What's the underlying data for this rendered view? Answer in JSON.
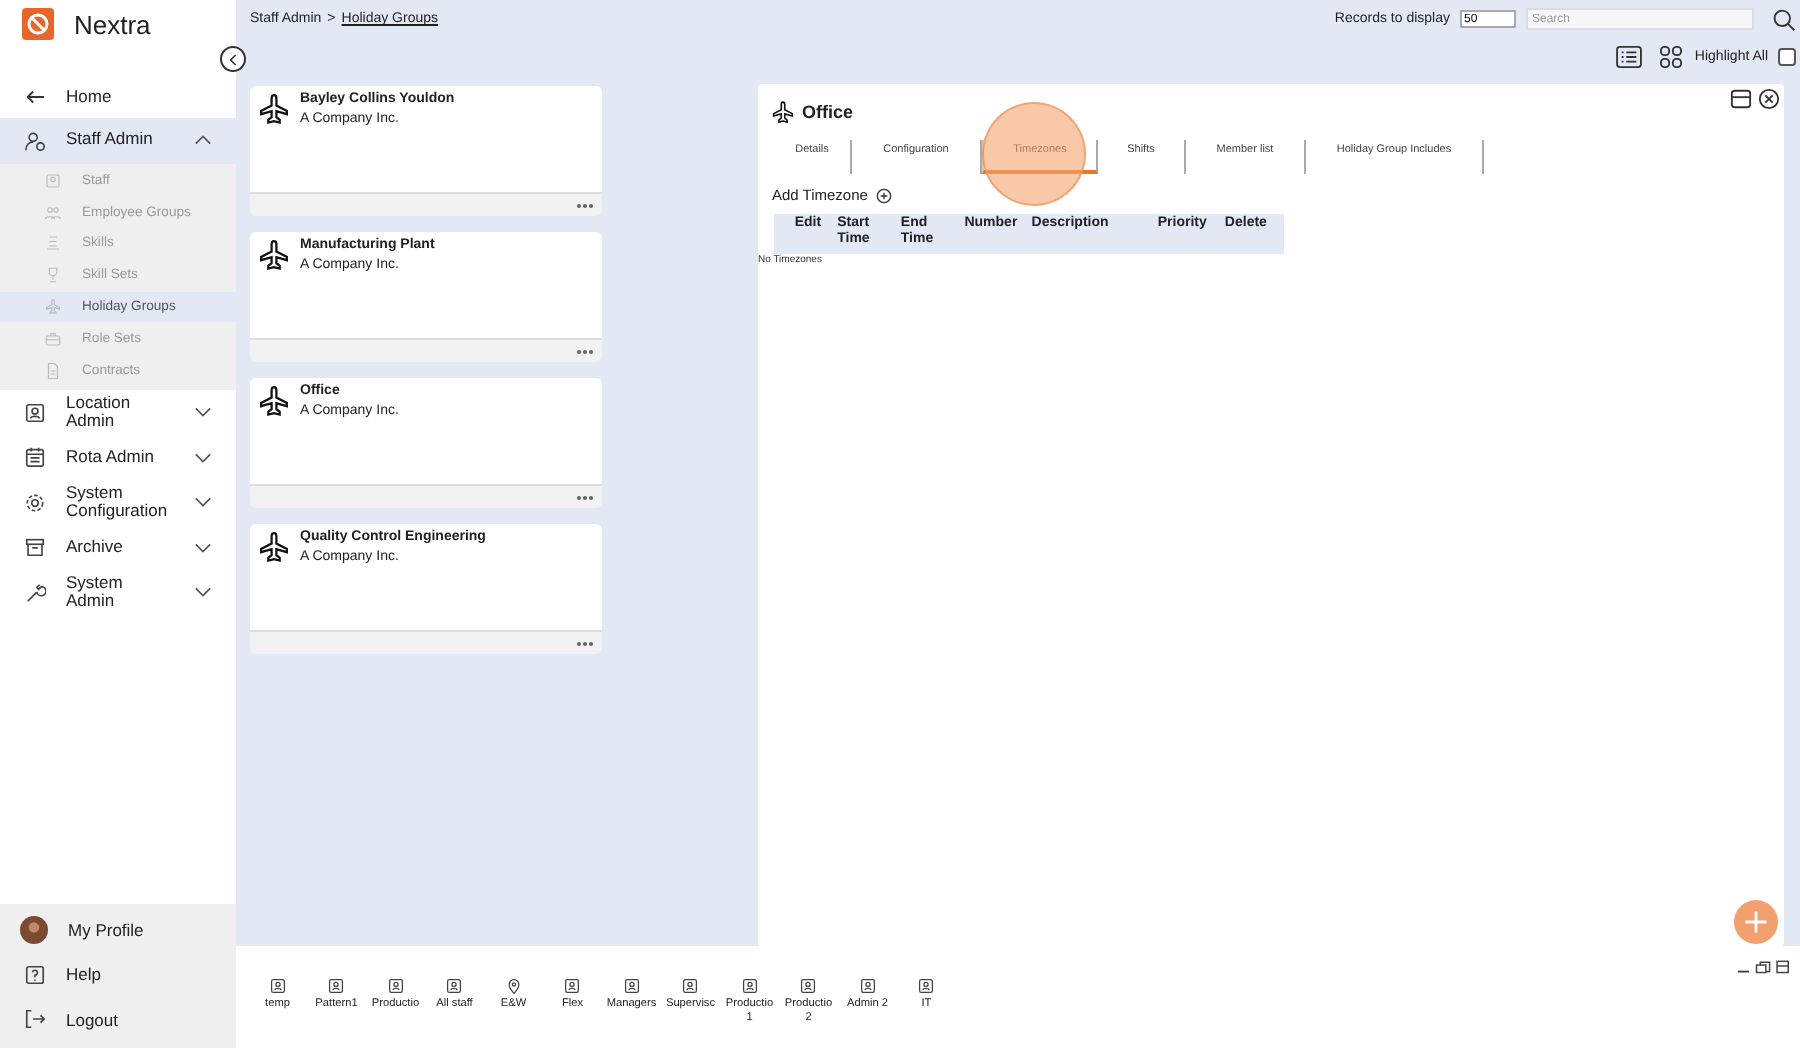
{
  "app": {
    "name": "Nextra"
  },
  "nav": {
    "home": "Home",
    "sections": [
      {
        "label": "Staff Admin",
        "expanded": true,
        "items": [
          {
            "label": "Staff",
            "selected": false
          },
          {
            "label": "Employee Groups",
            "selected": false
          },
          {
            "label": "Skills",
            "selected": false
          },
          {
            "label": "Skill Sets",
            "selected": false
          },
          {
            "label": "Holiday Groups",
            "selected": true
          },
          {
            "label": "Role Sets",
            "selected": false
          },
          {
            "label": "Contracts",
            "selected": false
          }
        ]
      },
      {
        "label": "Location Admin",
        "expanded": false
      },
      {
        "label": "Rota Admin",
        "expanded": false
      },
      {
        "label": "System Configuration",
        "expanded": false
      },
      {
        "label": "Archive",
        "expanded": false
      },
      {
        "label": "System Admin",
        "expanded": false
      }
    ]
  },
  "footer_nav": [
    {
      "label": "My Profile",
      "kind": "avatar"
    },
    {
      "label": "Help",
      "kind": "help"
    },
    {
      "label": "Logout",
      "kind": "logout"
    }
  ],
  "breadcrumb": {
    "parent": "Staff Admin",
    "separator": ">",
    "current": "Holiday Groups"
  },
  "toolbar": {
    "records_label": "Records to display",
    "records_value": "50",
    "search_placeholder": "Search",
    "highlight_label": "Highlight All",
    "highlight_checked": false
  },
  "cards": [
    {
      "title": "Bayley Collins Youldon",
      "subtitle": "A Company Inc."
    },
    {
      "title": "Manufacturing Plant",
      "subtitle": "A Company Inc."
    },
    {
      "title": "Office",
      "subtitle": "A Company Inc."
    },
    {
      "title": "Quality Control Engineering",
      "subtitle": "A Company Inc."
    }
  ],
  "detail": {
    "title": "Office",
    "tabs": [
      {
        "label": "Details",
        "selected": false
      },
      {
        "label": "Configuration",
        "selected": false
      },
      {
        "label": "Timezones",
        "selected": true
      },
      {
        "label": "Shifts",
        "selected": false
      },
      {
        "label": "Member list",
        "selected": false
      },
      {
        "label": "Holiday Group Includes",
        "selected": false
      }
    ],
    "add_label": "Add Timezone",
    "columns": [
      "Edit",
      "Start Time",
      "End Time",
      "Number",
      "Description",
      "Priority",
      "Delete"
    ],
    "empty": "No Timezones"
  },
  "groups": [
    {
      "label": "temp",
      "kind": "person"
    },
    {
      "label": "Pattern1",
      "kind": "person"
    },
    {
      "label": "Productio",
      "kind": "person"
    },
    {
      "label": "All staff",
      "kind": "person"
    },
    {
      "label": "E&W",
      "kind": "pin"
    },
    {
      "label": "Flex",
      "kind": "person"
    },
    {
      "label": "Managers",
      "kind": "person"
    },
    {
      "label": "Supervisc",
      "kind": "person"
    },
    {
      "label": "Productio 1",
      "kind": "person"
    },
    {
      "label": "Productio 2",
      "kind": "person"
    },
    {
      "label": "Admin 2",
      "kind": "person"
    },
    {
      "label": "IT",
      "kind": "person"
    }
  ]
}
